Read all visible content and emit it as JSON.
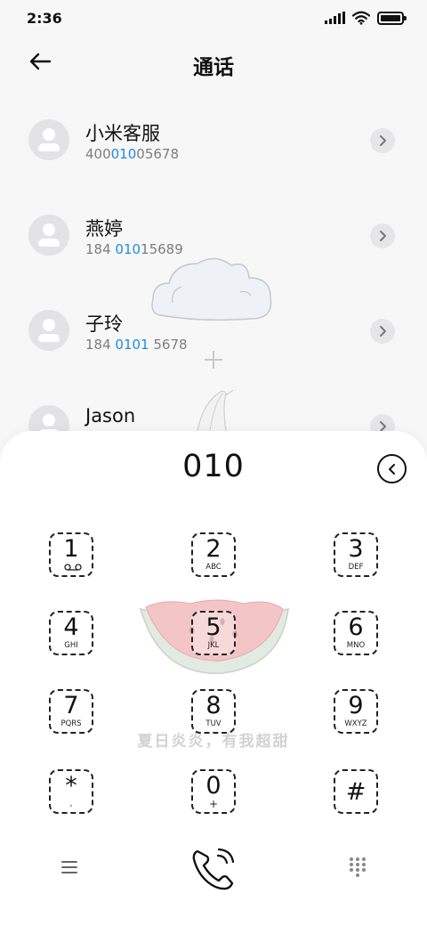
{
  "status_bar": {
    "time": "2:36"
  },
  "header": {
    "title": "通话"
  },
  "contacts": [
    {
      "name": "小米客服",
      "number_before": "400",
      "number_match": "010",
      "number_after": "05678"
    },
    {
      "name": "燕婷",
      "number_before": "184 ",
      "number_match": "010",
      "number_after": "15689"
    },
    {
      "name": "子玲",
      "number_before": "184 ",
      "number_match": "0101",
      "number_after": " 5678"
    },
    {
      "name": "Jason",
      "number_before": "",
      "number_match": "",
      "number_after": ""
    }
  ],
  "dialer": {
    "input": "010",
    "keys": [
      {
        "digit": "1",
        "letters": ""
      },
      {
        "digit": "2",
        "letters": "ABC"
      },
      {
        "digit": "3",
        "letters": "DEF"
      },
      {
        "digit": "4",
        "letters": "GHI"
      },
      {
        "digit": "5",
        "letters": "JKL"
      },
      {
        "digit": "6",
        "letters": "MNO"
      },
      {
        "digit": "7",
        "letters": "PQRS"
      },
      {
        "digit": "8",
        "letters": "TUV"
      },
      {
        "digit": "9",
        "letters": "WXYZ"
      },
      {
        "digit": "*",
        "letters": ","
      },
      {
        "digit": "0",
        "letters": "+"
      },
      {
        "digit": "#",
        "letters": ""
      }
    ],
    "theme_slogan": "夏日炎炎，有我超甜"
  },
  "colors": {
    "highlight": "#1e8be0",
    "background": "#f7f7f7",
    "sheet": "#ffffff"
  },
  "icons": {
    "back": "arrow-left-icon",
    "detail": "chevron-right-icon",
    "delete": "chevron-left-circle-icon",
    "voicemail": "voicemail-icon",
    "menu": "menu-icon",
    "call": "phone-icon",
    "keypad": "dialpad-icon"
  }
}
